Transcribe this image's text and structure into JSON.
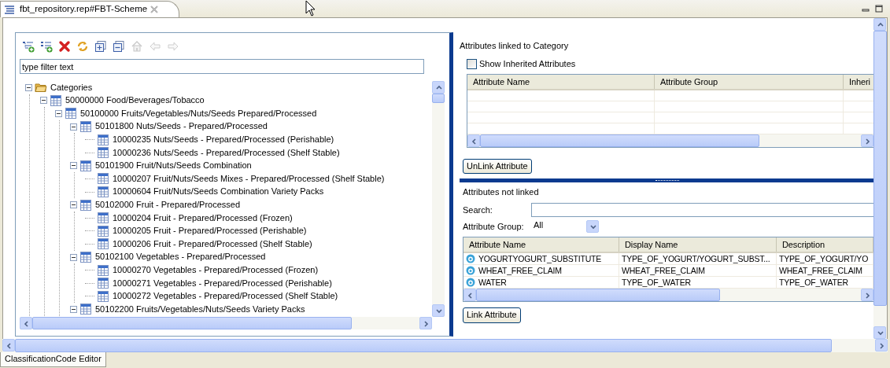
{
  "editor_tab": {
    "title": "fbt_repository.rep#FBT-Scheme",
    "selected": true
  },
  "toolbar": [
    {
      "kind": "add_child",
      "disabled": false
    },
    {
      "kind": "add_sibling",
      "disabled": false
    },
    {
      "kind": "delete",
      "disabled": false
    },
    {
      "kind": "refresh",
      "disabled": false
    },
    {
      "kind": "expand_all",
      "disabled": false
    },
    {
      "kind": "collapse_all",
      "disabled": false
    },
    {
      "kind": "home",
      "disabled": true
    },
    {
      "kind": "back",
      "disabled": true
    },
    {
      "kind": "forward",
      "disabled": true
    }
  ],
  "filter": {
    "value": "type filter text"
  },
  "tree": [
    {
      "label": "Categories",
      "kind": "folder",
      "expanded": true,
      "children": [
        {
          "label": "50000000 Food/Beverages/Tobacco",
          "kind": "category",
          "expanded": true,
          "children": [
            {
              "label": "50100000 Fruits/Vegetables/Nuts/Seeds Prepared/Processed",
              "kind": "category",
              "expanded": true,
              "children": [
                {
                  "label": "50101800 Nuts/Seeds - Prepared/Processed",
                  "kind": "category",
                  "expanded": true,
                  "children": [
                    {
                      "label": "10000235 Nuts/Seeds - Prepared/Processed (Perishable)",
                      "kind": "category"
                    },
                    {
                      "label": "10000236 Nuts/Seeds - Prepared/Processed (Shelf Stable)",
                      "kind": "category"
                    }
                  ]
                },
                {
                  "label": "50101900 Fruit/Nuts/Seeds Combination",
                  "kind": "category",
                  "expanded": true,
                  "children": [
                    {
                      "label": "10000207 Fruit/Nuts/Seeds Mixes - Prepared/Processed (Shelf Stable)",
                      "kind": "category"
                    },
                    {
                      "label": "10000604 Fruit/Nuts/Seeds Combination Variety Packs",
                      "kind": "category"
                    }
                  ]
                },
                {
                  "label": "50102000 Fruit - Prepared/Processed",
                  "kind": "category",
                  "expanded": true,
                  "children": [
                    {
                      "label": "10000204 Fruit - Prepared/Processed (Frozen)",
                      "kind": "category"
                    },
                    {
                      "label": "10000205 Fruit - Prepared/Processed (Perishable)",
                      "kind": "category"
                    },
                    {
                      "label": "10000206 Fruit - Prepared/Processed (Shelf Stable)",
                      "kind": "category"
                    }
                  ]
                },
                {
                  "label": "50102100 Vegetables - Prepared/Processed",
                  "kind": "category",
                  "expanded": true,
                  "children": [
                    {
                      "label": "10000270 Vegetables - Prepared/Processed (Frozen)",
                      "kind": "category"
                    },
                    {
                      "label": "10000271 Vegetables - Prepared/Processed (Perishable)",
                      "kind": "category"
                    },
                    {
                      "label": "10000272 Vegetables - Prepared/Processed (Shelf Stable)",
                      "kind": "category"
                    }
                  ]
                },
                {
                  "label": "50102200 Fruits/Vegetables/Nuts/Seeds Variety Packs",
                  "kind": "category",
                  "expanded": true
                }
              ]
            }
          ]
        }
      ]
    }
  ],
  "linked": {
    "title": "Attributes linked to Category",
    "show_inherited": {
      "label": "Show Inherited Attributes",
      "checked": false
    },
    "columns": [
      "Attribute Name",
      "Attribute Group",
      "Inheri"
    ]
  },
  "unlink_button": "UnLink Attribute",
  "not_linked": {
    "title": "Attributes not linked",
    "search_label": "Search:",
    "group_label": "Attribute Group:",
    "group_value": "All",
    "columns": [
      "Attribute Name",
      "Display Name",
      "Description"
    ],
    "rows": [
      [
        "YOGURTYOGURT_SUBSTITUTE",
        "TYPE_OF_YOGURT/YOGURT_SUBST...",
        "TYPE_OF_YOGURT/YO"
      ],
      [
        "WHEAT_FREE_CLAIM",
        "WHEAT_FREE_CLAIM",
        "WHEAT_FREE_CLAIM"
      ],
      [
        "WATER",
        "TYPE_OF_WATER",
        "TYPE_OF_WATER"
      ]
    ]
  },
  "link_button": "Link Attribute",
  "bottom_tab": {
    "title": "ClassificationCode Editor",
    "selected": true
  }
}
